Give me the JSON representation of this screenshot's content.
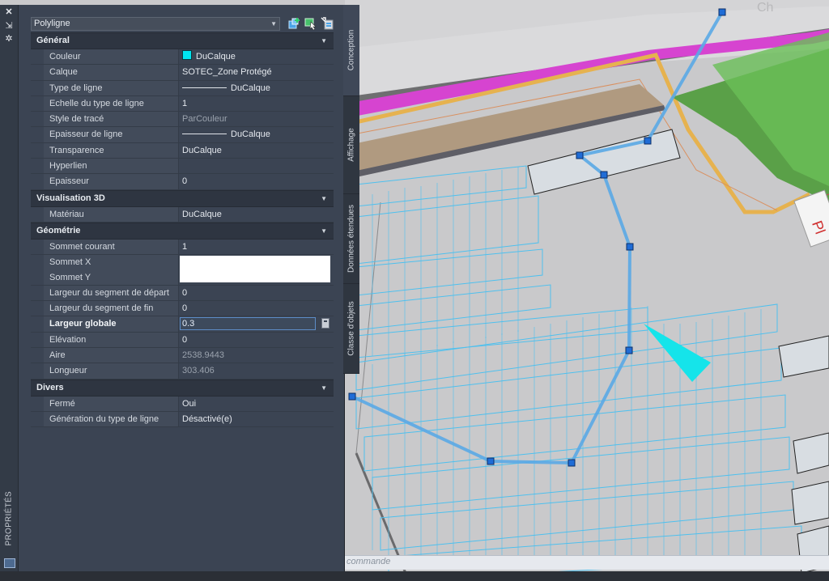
{
  "palette": {
    "title": "PROPRIÉTÉS",
    "object_type": "Polyligne",
    "icons": [
      "close-icon",
      "pin-icon",
      "settings-icon"
    ],
    "toolbar_icons": [
      "quick-select-icon",
      "select-objects-icon",
      "toggle-pickadd-icon"
    ],
    "sections": [
      {
        "title": "Général",
        "rows": [
          {
            "label": "Couleur",
            "value": "DuCalque",
            "color": "#00e5f0"
          },
          {
            "label": "Calque",
            "value": "SOTEC_Zone Protégé"
          },
          {
            "label": "Type de ligne",
            "value": "DuCalque"
          },
          {
            "label": "Echelle du type de ligne",
            "value": "1"
          },
          {
            "label": "Style de tracé",
            "value": "ParCouleur"
          },
          {
            "label": "Epaisseur de ligne",
            "value": "DuCalque"
          },
          {
            "label": "Transparence",
            "value": "DuCalque"
          },
          {
            "label": "Hyperlien",
            "value": ""
          },
          {
            "label": "Epaisseur",
            "value": "0"
          }
        ]
      },
      {
        "title": "Visualisation 3D",
        "rows": [
          {
            "label": "Matériau",
            "value": "DuCalque"
          }
        ]
      },
      {
        "title": "Géométrie",
        "rows": [
          {
            "label": "Sommet courant",
            "value": "1"
          },
          {
            "label": "Sommet X",
            "value": ""
          },
          {
            "label": "Sommet Y",
            "value": ""
          },
          {
            "label": "Largeur du segment de départ",
            "value": "0"
          },
          {
            "label": "Largeur du segment de fin",
            "value": "0"
          },
          {
            "label": "Largeur globale",
            "value": "0.3"
          },
          {
            "label": "Elévation",
            "value": "0"
          },
          {
            "label": "Aire",
            "value": "2538.9443"
          },
          {
            "label": "Longueur",
            "value": "303.406"
          }
        ]
      },
      {
        "title": "Divers",
        "rows": [
          {
            "label": "Fermé",
            "value": "Oui"
          },
          {
            "label": "Génération du type de ligne",
            "value": "Désactivé(e)"
          }
        ]
      }
    ]
  },
  "side_tabs": [
    "Conception",
    "Affichage",
    "Données étendues",
    "Classe d'objets"
  ],
  "drawing": {
    "label_top": "Ch",
    "label_right": "Pl",
    "command_placeholder": "commande"
  }
}
